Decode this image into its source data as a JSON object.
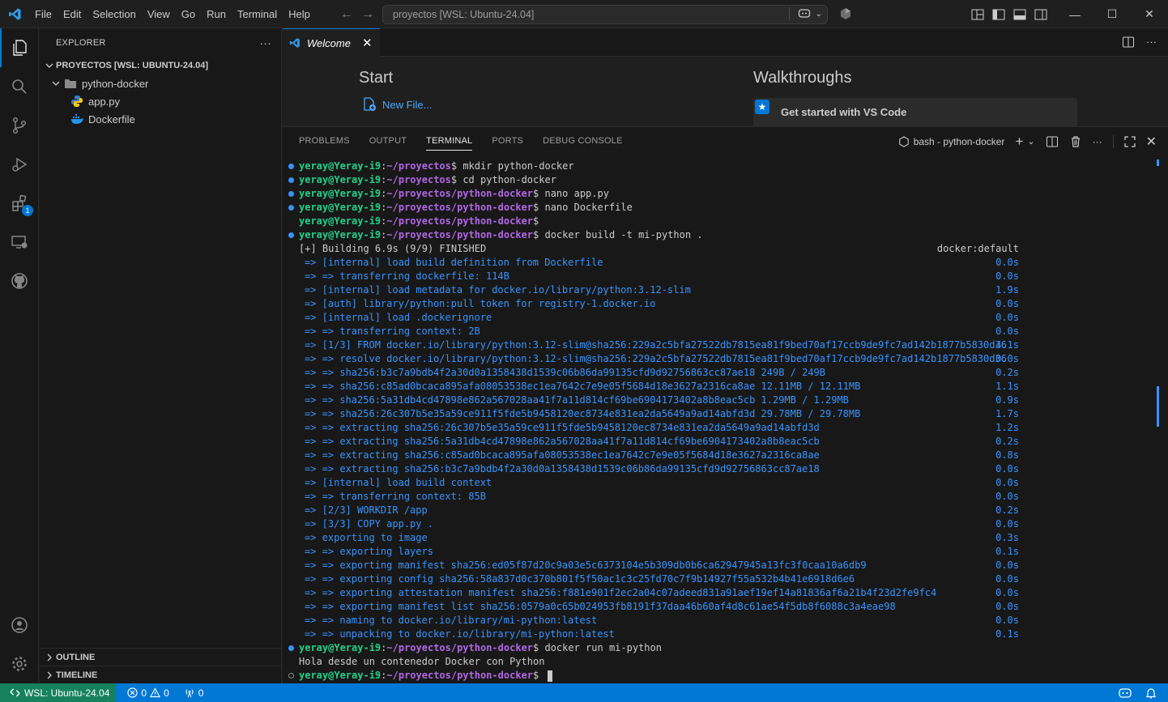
{
  "titlebar": {
    "menu": [
      "File",
      "Edit",
      "Selection",
      "View",
      "Go",
      "Run",
      "Terminal",
      "Help"
    ],
    "search_text": "proyectos [WSL: Ubuntu-24.04]"
  },
  "activity_badge": "1",
  "sidebar": {
    "title": "EXPLORER",
    "more": "···",
    "root": "PROYECTOS [WSL: UBUNTU-24.04]",
    "folder": "python-docker",
    "files": [
      "app.py",
      "Dockerfile"
    ],
    "outline": "OUTLINE",
    "timeline": "TIMELINE"
  },
  "editor": {
    "tab": "Welcome",
    "start_title": "Start",
    "new_file": "New File...",
    "walkthroughs_title": "Walkthroughs",
    "walkthrough_item": "Get started with VS Code"
  },
  "panel": {
    "tabs": [
      "PROBLEMS",
      "OUTPUT",
      "TERMINAL",
      "PORTS",
      "DEBUG CONSOLE"
    ],
    "active_tab": "TERMINAL",
    "terminal_name": "bash - python-docker"
  },
  "terminal": {
    "prompts": [
      {
        "user": "yeray@Yeray-i9",
        "path": "~/proyectos",
        "cmd": " mkdir python-docker"
      },
      {
        "user": "yeray@Yeray-i9",
        "path": "~/proyectos",
        "cmd": " cd python-docker"
      },
      {
        "user": "yeray@Yeray-i9",
        "path": "~/proyectos/python-docker",
        "cmd": " nano app.py"
      },
      {
        "user": "yeray@Yeray-i9",
        "path": "~/proyectos/python-docker",
        "cmd": " nano Dockerfile"
      },
      {
        "user": "yeray@Yeray-i9",
        "path": "~/proyectos/python-docker",
        "cmd": ""
      },
      {
        "user": "yeray@Yeray-i9",
        "path": "~/proyectos/python-docker",
        "cmd": " docker build -t mi-python ."
      }
    ],
    "build_header": "[+] Building 6.9s (9/9) FINISHED",
    "build_context": "docker:default",
    "build_steps": [
      {
        "text": "=> [internal] load build definition from Dockerfile",
        "time": "0.0s"
      },
      {
        "text": "=> => transferring dockerfile: 114B",
        "time": "0.0s"
      },
      {
        "text": "=> [internal] load metadata for docker.io/library/python:3.12-slim",
        "time": "1.9s"
      },
      {
        "text": "=> [auth] library/python:pull token for registry-1.docker.io",
        "time": "0.0s"
      },
      {
        "text": "=> [internal] load .dockerignore",
        "time": "0.0s"
      },
      {
        "text": "=> => transferring context: 2B",
        "time": "0.0s"
      },
      {
        "text": "=> [1/3] FROM docker.io/library/python:3.12-slim@sha256:229a2c5bfa27522db7815ea81f9bed70af17ccb9de9fc7ad142b1877b5830d36",
        "time": "4.1s"
      },
      {
        "text": "=> => resolve docker.io/library/python:3.12-slim@sha256:229a2c5bfa27522db7815ea81f9bed70af17ccb9de9fc7ad142b1877b5830d36",
        "time": "0.0s"
      },
      {
        "text": "=> => sha256:b3c7a9bdb4f2a30d0a1358438d1539c06b86da99135cfd9d92756863cc87ae18 249B / 249B",
        "time": "0.2s"
      },
      {
        "text": "=> => sha256:c85ad0bcaca895afa08053538ec1ea7642c7e9e05f5684d18e3627a2316ca8ae 12.11MB / 12.11MB",
        "time": "1.1s"
      },
      {
        "text": "=> => sha256:5a31db4cd47898e862a567028aa41f7a11d814cf69be6904173402a8b8eac5cb 1.29MB / 1.29MB",
        "time": "0.9s"
      },
      {
        "text": "=> => sha256:26c307b5e35a59ce911f5fde5b9458120ec8734e831ea2da5649a9ad14abfd3d 29.78MB / 29.78MB",
        "time": "1.7s"
      },
      {
        "text": "=> => extracting sha256:26c307b5e35a59ce911f5fde5b9458120ec8734e831ea2da5649a9ad14abfd3d",
        "time": "1.2s"
      },
      {
        "text": "=> => extracting sha256:5a31db4cd47898e862a567028aa41f7a11d814cf69be6904173402a8b8eac5cb",
        "time": "0.2s"
      },
      {
        "text": "=> => extracting sha256:c85ad0bcaca895afa08053538ec1ea7642c7e9e05f5684d18e3627a2316ca8ae",
        "time": "0.8s"
      },
      {
        "text": "=> => extracting sha256:b3c7a9bdb4f2a30d0a1358438d1539c06b86da99135cfd9d92756863cc87ae18",
        "time": "0.0s"
      },
      {
        "text": "=> [internal] load build context",
        "time": "0.0s"
      },
      {
        "text": "=> => transferring context: 85B",
        "time": "0.0s"
      },
      {
        "text": "=> [2/3] WORKDIR /app",
        "time": "0.2s"
      },
      {
        "text": "=> [3/3] COPY app.py .",
        "time": "0.0s"
      },
      {
        "text": "=> exporting to image",
        "time": "0.3s"
      },
      {
        "text": "=> => exporting layers",
        "time": "0.1s"
      },
      {
        "text": "=> => exporting manifest sha256:ed05f87d20c9a03e5c6373104e5b309db0b6ca62947945a13fc3f0caa10a6db9",
        "time": "0.0s"
      },
      {
        "text": "=> => exporting config sha256:58a837d0c370b801f5f50ac1c3c25fd70c7f9b14927f55a532b4b41e6918d6e6",
        "time": "0.0s"
      },
      {
        "text": "=> => exporting attestation manifest sha256:f881e901f2ec2a04c07adeed831a91aef19ef14a81836af6a21b4f23d2fe9fc4",
        "time": "0.0s"
      },
      {
        "text": "=> => exporting manifest list sha256:0579a0c65b024953fb8191f37daa46b60af4d8c61ae54f5db8f6088c3a4eae98",
        "time": "0.0s"
      },
      {
        "text": "=> => naming to docker.io/library/mi-python:latest",
        "time": "0.0s"
      },
      {
        "text": "=> => unpacking to docker.io/library/mi-python:latest",
        "time": "0.1s"
      }
    ],
    "run_prompt": {
      "user": "yeray@Yeray-i9",
      "path": "~/proyectos/python-docker",
      "cmd": " docker run mi-python"
    },
    "output": "Hola desde un contenedor Docker con Python",
    "last_prompt": {
      "user": "yeray@Yeray-i9",
      "path": "~/proyectos/python-docker",
      "cmd": " "
    }
  },
  "statusbar": {
    "remote": "WSL: Ubuntu-24.04",
    "errors": "0",
    "warnings": "0",
    "ports": "0"
  },
  "colors": {
    "accent": "#0078d4",
    "remote": "#16825d",
    "prompt_user": "#23d18b",
    "prompt_path": "#b267e6",
    "build_blue": "#3794ff"
  }
}
